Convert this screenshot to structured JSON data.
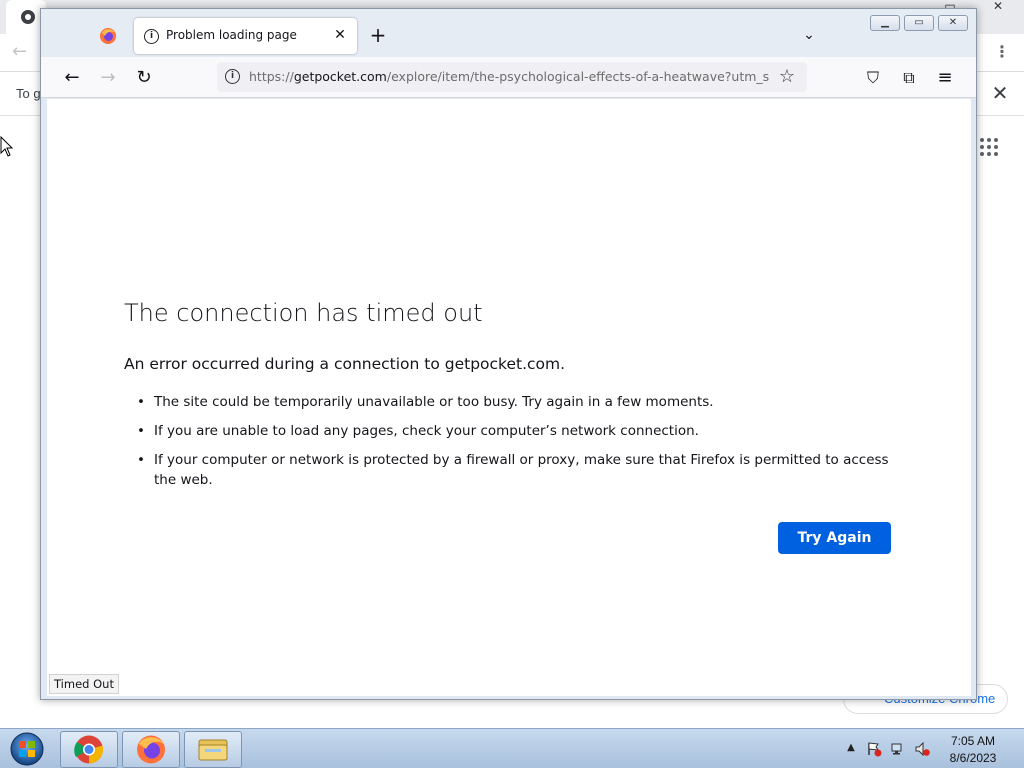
{
  "chrome": {
    "infobar_text": "To g",
    "infobar_close": "✕",
    "menu": "⋮",
    "back": "←",
    "customize_label": "Customize Chrome",
    "window_controls": [
      "▭",
      "✕"
    ]
  },
  "firefox": {
    "tab": {
      "title": "Problem loading page",
      "close": "✕"
    },
    "new_tab": "+",
    "tab_list": "⌄",
    "window_controls": {
      "minimize": "▁",
      "restore": "▭",
      "close": "✕"
    },
    "nav": {
      "back": "←",
      "forward": "→",
      "reload": "↻",
      "bookmark": "☆",
      "pocket": "⛉",
      "extensions": "⧉",
      "menu": "≡"
    },
    "url": {
      "scheme": "https://",
      "host": "getpocket.com",
      "path": "/explore/item/the-psychological-effects-of-a-heatwave?utm_so"
    },
    "error": {
      "title": "The connection has timed out",
      "subtitle": "An error occurred during a connection to getpocket.com.",
      "items": [
        "The site could be temporarily unavailable or too busy. Try again in a few moments.",
        "If you are unable to load any pages, check your computer’s network connection.",
        "If your computer or network is protected by a firewall or proxy, make sure that Firefox is permitted to access the web."
      ],
      "button": "Try Again"
    },
    "status": "Timed Out"
  },
  "taskbar": {
    "apps": [
      "chrome-icon",
      "firefox-icon",
      "file-explorer-icon"
    ],
    "tray_arrow": "▲",
    "time": "7:05 AM",
    "date": "8/6/2023"
  },
  "colors": {
    "accent": "#0061e0",
    "text": "#15141a",
    "taskbar": "#b6cbe4"
  }
}
